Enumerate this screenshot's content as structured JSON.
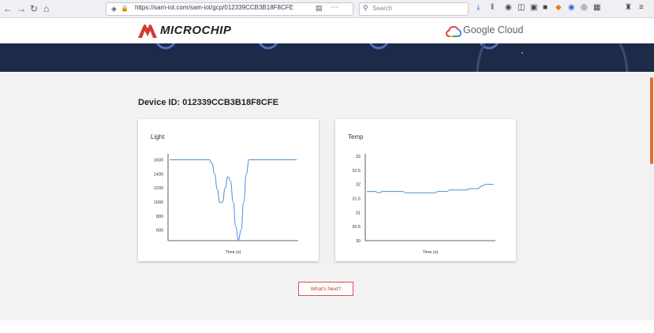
{
  "browser": {
    "url": "https://sam-iot.com/sam-iot/gcp/012339CCB3B18F8CFE",
    "search_placeholder": "Search",
    "back_icon": "back-arrow-icon",
    "forward_icon": "forward-arrow-icon",
    "reload_icon": "reload-icon",
    "home_icon": "home-icon"
  },
  "header": {
    "brand_left": "Microchip",
    "brand_right": "Google Cloud"
  },
  "main": {
    "device_id_label": "Device ID: 012339CCB3B18F8CFE",
    "whats_next_label": "What's Next?"
  },
  "colors": {
    "line": "#4a90d9",
    "accent": "#d9534f",
    "hero": "#1d2a48"
  },
  "chart_data": [
    {
      "type": "line",
      "title": "Light",
      "xlabel": "Time (s)",
      "ylabel": "",
      "ylim": [
        450,
        1650
      ],
      "yticks": [
        600,
        800,
        1000,
        1200,
        1400,
        1600
      ],
      "series": [
        {
          "values": [
            1600,
            1600,
            1600,
            1600,
            1600,
            1600,
            1600,
            1600,
            1600,
            1600,
            1600,
            1600,
            1600,
            1600,
            1600,
            1600,
            1550,
            1400,
            1180,
            990,
            1000,
            1200,
            1360,
            1300,
            1000,
            650,
            460,
            600,
            1000,
            1400,
            1600,
            1600,
            1600,
            1600,
            1600,
            1600,
            1600,
            1600,
            1600,
            1600,
            1600,
            1600,
            1600,
            1600,
            1600,
            1600,
            1600,
            1600,
            1600
          ]
        }
      ]
    },
    {
      "type": "line",
      "title": "Temp",
      "xlabel": "Time (s)",
      "ylabel": "",
      "ylim": [
        30,
        33
      ],
      "yticks": [
        "30",
        "30.5",
        "31",
        "31.5",
        "32",
        "32.5",
        "33"
      ],
      "series": [
        {
          "values": [
            31.75,
            31.75,
            31.75,
            31.7,
            31.75,
            31.75,
            31.75,
            31.75,
            31.75,
            31.75,
            31.7,
            31.7,
            31.7,
            31.7,
            31.7,
            31.7,
            31.7,
            31.7,
            31.75,
            31.75,
            31.75,
            31.8,
            31.8,
            31.8,
            31.8,
            31.8,
            31.85,
            31.85,
            31.85,
            31.95,
            32.0,
            32.0,
            32.0
          ]
        }
      ]
    }
  ]
}
